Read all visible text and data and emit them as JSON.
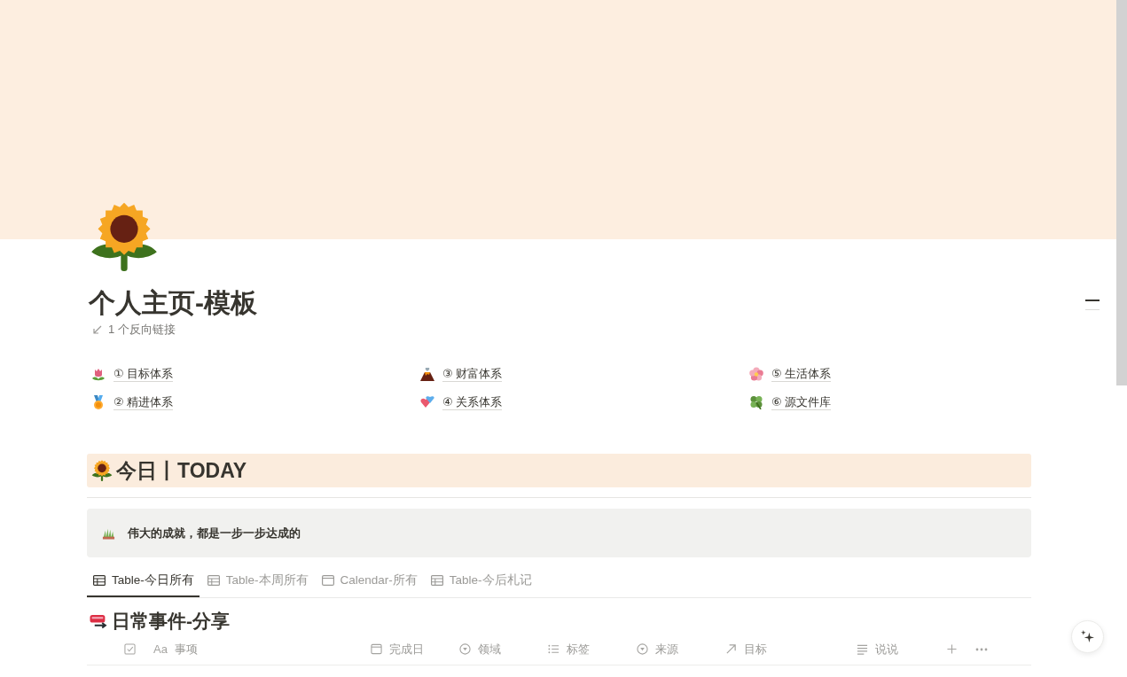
{
  "page": {
    "title": "个人主页-模板",
    "backlinks": "1 个反向链接"
  },
  "links": [
    {
      "label": "① 目标体系"
    },
    {
      "label": "② 精进体系"
    },
    {
      "label": "③ 财富体系"
    },
    {
      "label": "④ 关系体系"
    },
    {
      "label": "⑤ 生活体系"
    },
    {
      "label": "⑥ 源文件库"
    }
  ],
  "today_heading": {
    "title": "今日丨TODAY"
  },
  "callout": {
    "text": "伟大的成就，都是一步一步达成的"
  },
  "view_tabs": [
    {
      "label": "Table-今日所有",
      "kind": "table",
      "selected": true
    },
    {
      "label": "Table-本周所有",
      "kind": "table",
      "selected": false
    },
    {
      "label": "Calendar-所有",
      "kind": "calendar",
      "selected": false
    },
    {
      "label": "Table-今后札记",
      "kind": "table",
      "selected": false
    }
  ],
  "database": {
    "title": "日常事件-分享",
    "columns": [
      {
        "kind": "checkbox"
      },
      {
        "kind": "title",
        "icon": "Aa",
        "label": "事项"
      },
      {
        "kind": "date",
        "label": "完成日"
      },
      {
        "kind": "select",
        "label": "领域"
      },
      {
        "kind": "multi_select",
        "label": "标签"
      },
      {
        "kind": "select",
        "label": "来源"
      },
      {
        "kind": "relation",
        "label": "目标"
      },
      {
        "kind": "text",
        "label": "说说"
      }
    ]
  }
}
